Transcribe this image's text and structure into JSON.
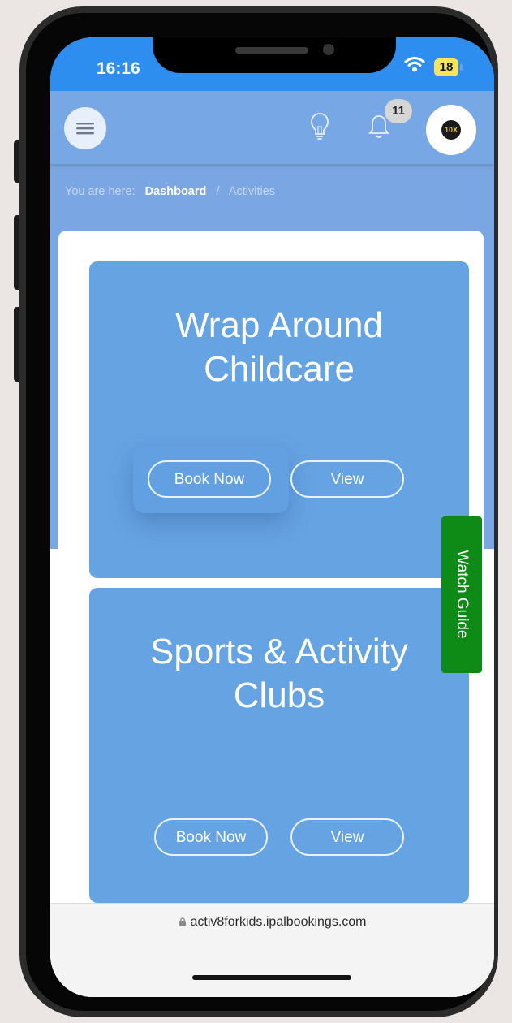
{
  "status_bar": {
    "time": "16:16",
    "battery": "18"
  },
  "header": {
    "notification_count": "11",
    "avatar_text": "10X"
  },
  "breadcrumb": {
    "prefix": "You are here:",
    "dashboard": "Dashboard",
    "separator": "/",
    "current": "Activities"
  },
  "cards": [
    {
      "title_line1": "Wrap Around",
      "title_line2": "Childcare",
      "book_label": "Book Now",
      "view_label": "View"
    },
    {
      "title_line1": "Sports & Activity",
      "title_line2": "Clubs",
      "book_label": "Book Now",
      "view_label": "View"
    }
  ],
  "watch_guide": {
    "label": "Watch Guide"
  },
  "browser": {
    "url": "activ8forkids.ipalbookings.com"
  },
  "colors": {
    "card_blue": "#66a3e3",
    "header_blue": "#78a7e6",
    "status_blue": "#2d8ef0",
    "guide_green": "#0d8b16"
  }
}
